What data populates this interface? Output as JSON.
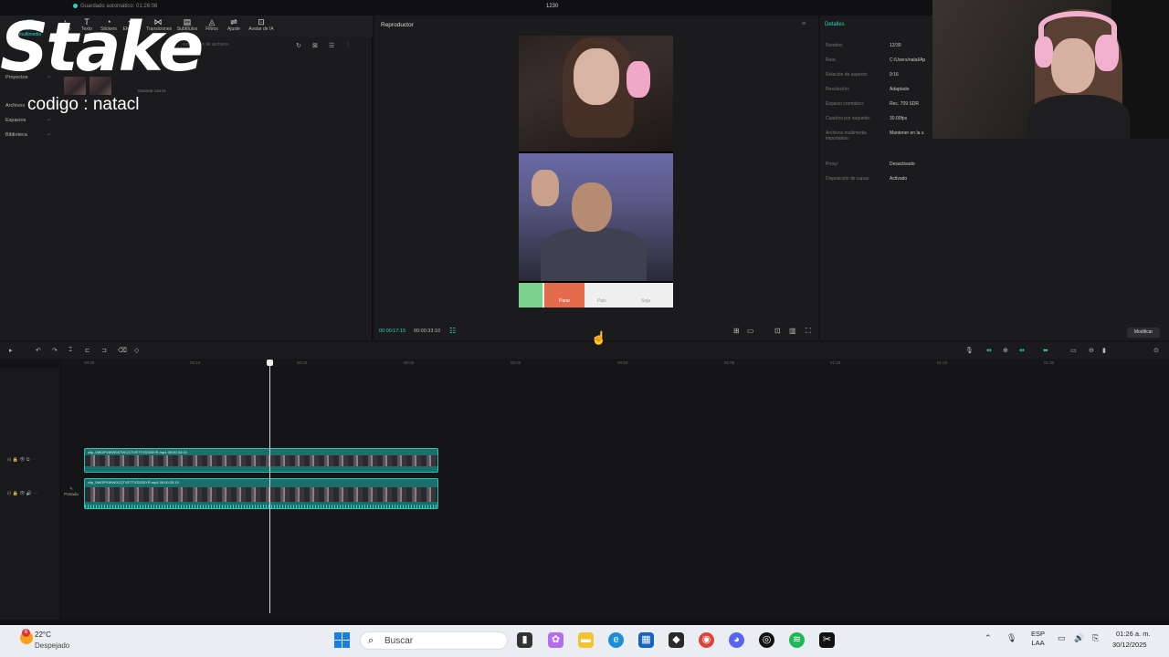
{
  "titlebar": {
    "autosave": "Guardado automático: 01:26:08",
    "project": "1230"
  },
  "toolbar": {
    "tools": [
      {
        "label": "Archivos multimedia",
        "icon": "media-icon"
      },
      {
        "label": "Audio",
        "icon": "audio-icon"
      },
      {
        "label": "Texto",
        "icon": "text-icon"
      },
      {
        "label": "Stickers",
        "icon": "sticker-icon"
      },
      {
        "label": "Efectos",
        "icon": "effects-icon"
      },
      {
        "label": "Transiciones",
        "icon": "transition-icon"
      },
      {
        "label": "Subtítulos",
        "icon": "subtitle-icon"
      },
      {
        "label": "Filtros",
        "icon": "filter-icon"
      },
      {
        "label": "Ajuste",
        "icon": "adjust-icon"
      },
      {
        "label": "Avatar de IA",
        "icon": "ai-avatar-icon"
      }
    ]
  },
  "media": {
    "search_placeholder": "o nombres de archivos",
    "sidebar": [
      "Proyectos",
      "Archivos",
      "Espacios",
      "Biblioteca"
    ],
    "thumb_label": "Generar con IA"
  },
  "overlay": {
    "brand": "Stake",
    "code": "codigo : natacl"
  },
  "player": {
    "title": "Reproductor",
    "current": "00:00:17:15",
    "total": "00:00:33:10",
    "strip_labels": [
      "Parar",
      "Pais",
      "Soja"
    ]
  },
  "details": {
    "tab": "Detalles",
    "rows": [
      {
        "k": "Nombre:",
        "v": "12/30"
      },
      {
        "k": "Ruta:",
        "v": "C:/Users/natal/Ap"
      },
      {
        "k": "Relación de aspecto:",
        "v": "9:16"
      },
      {
        "k": "Resolución:",
        "v": "Adaptado"
      },
      {
        "k": "Espacio cromático:",
        "v": "Rec. 709 SDR"
      },
      {
        "k": "Cuadros por segundo:",
        "v": "30.00fps"
      },
      {
        "k": "Archivos multimedia importados:",
        "v": "Mantener en la u"
      },
      {
        "k": "Proxy:",
        "v": "Desactivado"
      },
      {
        "k": "Disposición de capas:",
        "v": "Activado"
      }
    ],
    "modify": "Modificar"
  },
  "timeline": {
    "ticks": [
      "00:00",
      "00:10",
      "00:20",
      "00:30",
      "00:40",
      "00:50",
      "01:00",
      "01:10",
      "01:20",
      "01:30"
    ],
    "clip1": "clip_0WOPVWW0STWCGTVE7TVD333YR.mp4  00:00:33:10",
    "clip2": "clip_0WOPVWW0CQTVE7TVD333YR.mp4  00:00:33:10",
    "cover": "Portada"
  },
  "taskbar": {
    "temp": "22°C",
    "weather": "Despejado",
    "weather_badge": "6",
    "search": "Buscar",
    "lang1": "ESP",
    "lang2": "LAA",
    "time": "01:26 a. m.",
    "date": "30/12/2025"
  }
}
